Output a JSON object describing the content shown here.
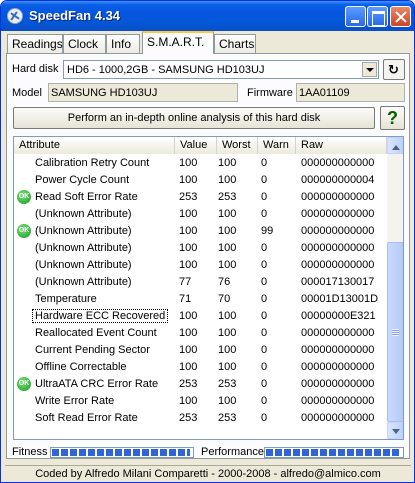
{
  "window": {
    "title": "SpeedFan 4.34"
  },
  "tabs": [
    {
      "label": "Readings"
    },
    {
      "label": "Clock"
    },
    {
      "label": "Info"
    },
    {
      "label": "S.M.A.R.T."
    },
    {
      "label": "Charts"
    }
  ],
  "smart": {
    "hard_disk_label": "Hard disk",
    "hard_disk_value": "HD6 - 1000,2GB - SAMSUNG HD103UJ",
    "model_label": "Model",
    "model_value": "SAMSUNG HD103UJ",
    "firmware_label": "Firmware",
    "firmware_value": "1AA01109",
    "analyze_button": "Perform an in-depth online analysis of this hard disk",
    "help_button": "?",
    "columns": [
      "Attribute",
      "Value",
      "Worst",
      "Warn",
      "Raw"
    ],
    "ok_badge": "OK",
    "rows": [
      {
        "ok": false,
        "attribute": "Calibration Retry Count",
        "value": "100",
        "worst": "100",
        "warn": "0",
        "raw": "000000000000"
      },
      {
        "ok": false,
        "attribute": "Power Cycle Count",
        "value": "100",
        "worst": "100",
        "warn": "0",
        "raw": "000000000004"
      },
      {
        "ok": true,
        "attribute": "Read Soft Error Rate",
        "value": "253",
        "worst": "253",
        "warn": "0",
        "raw": "000000000000"
      },
      {
        "ok": false,
        "attribute": "(Unknown Attribute)",
        "value": "100",
        "worst": "100",
        "warn": "0",
        "raw": "000000000000"
      },
      {
        "ok": true,
        "attribute": "(Unknown Attribute)",
        "value": "100",
        "worst": "100",
        "warn": "99",
        "raw": "000000000000"
      },
      {
        "ok": false,
        "attribute": "(Unknown Attribute)",
        "value": "100",
        "worst": "100",
        "warn": "0",
        "raw": "000000000000"
      },
      {
        "ok": false,
        "attribute": "(Unknown Attribute)",
        "value": "100",
        "worst": "100",
        "warn": "0",
        "raw": "000000000000"
      },
      {
        "ok": false,
        "attribute": "(Unknown Attribute)",
        "value": "77",
        "worst": "76",
        "warn": "0",
        "raw": "000017130017"
      },
      {
        "ok": false,
        "attribute": "Temperature",
        "value": "71",
        "worst": "70",
        "warn": "0",
        "raw": "00001D13001D"
      },
      {
        "ok": false,
        "attribute": "Hardware ECC Recovered",
        "value": "100",
        "worst": "100",
        "warn": "0",
        "raw": "00000000E321",
        "selected": true
      },
      {
        "ok": false,
        "attribute": "Reallocated Event Count",
        "value": "100",
        "worst": "100",
        "warn": "0",
        "raw": "000000000000"
      },
      {
        "ok": false,
        "attribute": "Current Pending Sector",
        "value": "100",
        "worst": "100",
        "warn": "0",
        "raw": "000000000000"
      },
      {
        "ok": false,
        "attribute": "Offline Correctable",
        "value": "100",
        "worst": "100",
        "warn": "0",
        "raw": "000000000000"
      },
      {
        "ok": true,
        "attribute": "UltraATA CRC Error Rate",
        "value": "253",
        "worst": "253",
        "warn": "0",
        "raw": "000000000000"
      },
      {
        "ok": false,
        "attribute": "Write Error Rate",
        "value": "100",
        "worst": "100",
        "warn": "0",
        "raw": "000000000000"
      },
      {
        "ok": false,
        "attribute": "Soft Read Error Rate",
        "value": "253",
        "worst": "253",
        "warn": "0",
        "raw": "000000000000"
      }
    ],
    "fitness_label": "Fitness",
    "fitness_level": 1.0,
    "performance_label": "Performance",
    "performance_level": 1.0
  },
  "status_bar": "Coded by Alfredo Milani Comparetti - 2000-2008 - alfredo@almico.com",
  "colors": {
    "titlebar": "#0655e0",
    "ok_badge": "#0f9a1a",
    "meter_fill": "#2f65d6"
  },
  "icons": [
    "app-fan-icon",
    "minimize-icon",
    "maximize-icon",
    "close-icon",
    "refresh-icon",
    "help-icon",
    "ok-icon",
    "scroll-up-icon",
    "scroll-down-icon"
  ]
}
